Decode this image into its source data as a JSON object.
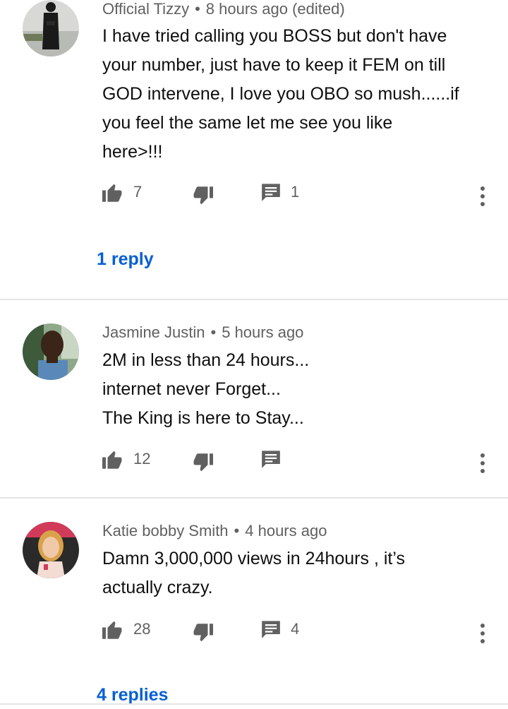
{
  "comments": [
    {
      "author": "Official Tizzy",
      "time": "8 hours ago (edited)",
      "text_lines": [
        "I have tried calling you BOSS but don't have",
        "your number, just have to keep it FEM on till",
        "GOD intervene, I love you OBO so mush......if",
        "you feel the same let me see you like",
        "here>!!!"
      ],
      "likes": "7",
      "replies_count": "1",
      "replies_link": "1 reply"
    },
    {
      "author": "Jasmine Justin",
      "time": "5 hours ago",
      "text_lines": [
        "2M in less than 24 hours...",
        "internet never Forget...",
        "The King is here to Stay..."
      ],
      "likes": "12",
      "replies_count": "",
      "replies_link": ""
    },
    {
      "author": "Katie bobby Smith",
      "time": "4 hours ago",
      "text_lines": [
        "Damn 3,000,000 views in 24hours , it’s",
        "actually crazy."
      ],
      "likes": "28",
      "replies_count": "4",
      "replies_link": "4 replies"
    }
  ],
  "icons": {
    "like": "thumbs-up-icon",
    "dislike": "thumbs-down-icon",
    "reply": "comment-icon",
    "more": "more-vertical-icon"
  },
  "colors": {
    "link": "#065fd4",
    "secondary_text": "#606060",
    "icon": "#606060",
    "divider": "#e5e5e5"
  }
}
